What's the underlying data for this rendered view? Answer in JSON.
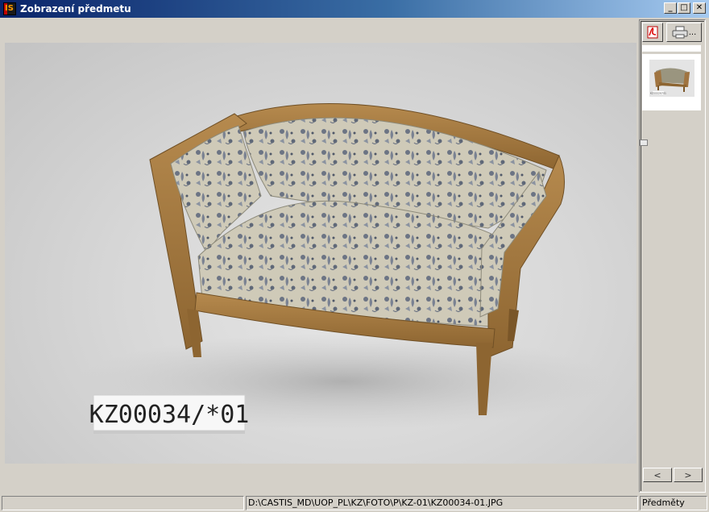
{
  "window": {
    "title": "Zobrazení předmetu",
    "icon_label": "IS",
    "buttons": {
      "minimize": "_",
      "maximize": "□",
      "close": "✕"
    }
  },
  "viewer": {
    "photo_subject": "upholstered sofa",
    "label_text": "KZ00034/*01"
  },
  "sidepanel": {
    "pdf_icon": "pdf-icon",
    "print_icon": "printer-icon",
    "print_more": "...",
    "thumbnail_label": "KZ00034/*01",
    "prev_label": "<",
    "next_label": ">"
  },
  "statusbar": {
    "left": "",
    "path": "D:\\CASTIS_MD\\UOP_PL\\KZ\\FOTO\\P\\KZ-01\\KZ00034-01.JPG",
    "right": "Předměty"
  }
}
